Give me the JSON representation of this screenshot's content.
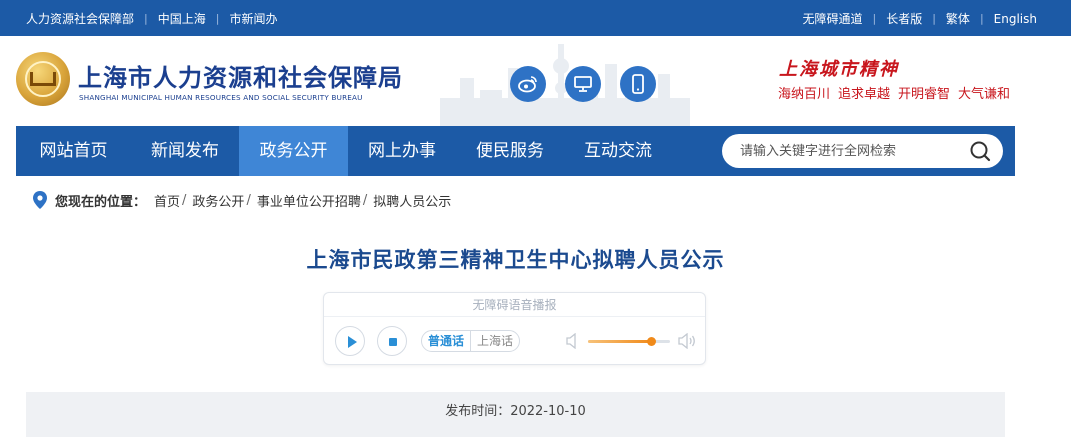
{
  "topbar": {
    "left_links": [
      "人力资源社会保障部",
      "中国上海",
      "市新闻办"
    ],
    "right_links": [
      "无障碍通道",
      "长者版",
      "繁体",
      "English"
    ],
    "separator": "|"
  },
  "header": {
    "logo_cn": "上海市人力资源和社会保障局",
    "logo_en": "SHANGHAI MUNICIPAL HUMAN RESOURCES AND SOCIAL SECURITY BUREAU",
    "icons": [
      "weibo-icon",
      "desktop-icon",
      "mobile-icon"
    ],
    "spirit_title": "上海城市精神",
    "spirit_items": [
      "海纳百川",
      "追求卓越",
      "开明睿智",
      "大气谦和"
    ]
  },
  "nav": {
    "items": [
      "网站首页",
      "新闻发布",
      "政务公开",
      "网上办事",
      "便民服务",
      "互动交流"
    ],
    "active_index": 2,
    "search_placeholder": "请输入关键字进行全网检索"
  },
  "breadcrumb": {
    "label": "您现在的位置：",
    "items": [
      "首页",
      "政务公开",
      "事业单位公开招聘",
      "拟聘人员公示"
    ],
    "separator": "/"
  },
  "article": {
    "title": "上海市民政第三精神卫生中心拟聘人员公示",
    "player": {
      "header": "无障碍语音播报",
      "lang_selected": "普通话",
      "lang_other": "上海话",
      "volume": 0.78
    },
    "publish_time": "发布时间：2022-10-10"
  },
  "colors": {
    "primary": "#1c5aa6",
    "nav_active": "#3f86d6",
    "title": "#1b4a8f",
    "spirit": "#c8161d",
    "accent_orange": "#f08a1a"
  }
}
